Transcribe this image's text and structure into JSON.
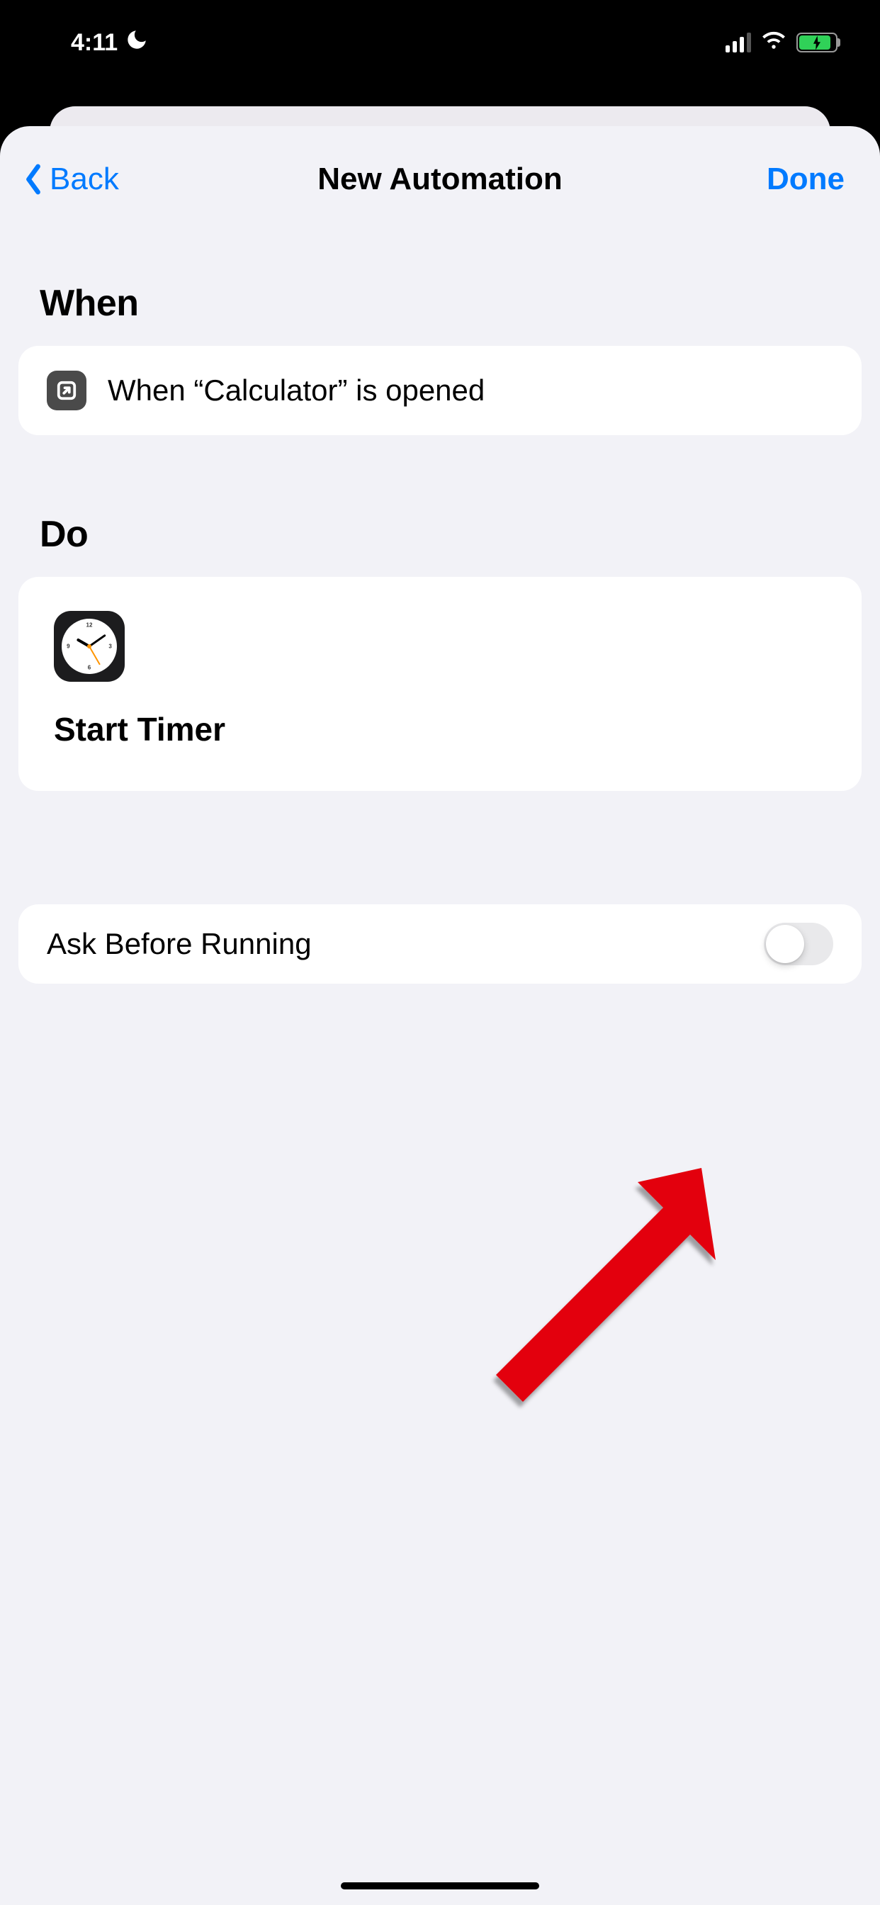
{
  "statusbar": {
    "time": "4:11",
    "dnd": true,
    "battery_charging": true
  },
  "nav": {
    "back_label": "Back",
    "title": "New Automation",
    "done_label": "Done"
  },
  "sections": {
    "when_title": "When",
    "do_title": "Do"
  },
  "when": {
    "trigger_text": "When “Calculator” is opened",
    "trigger_icon": "open-app"
  },
  "do": {
    "action_label": "Start Timer",
    "action_icon": "clock"
  },
  "options": {
    "ask_before_running": {
      "label": "Ask Before Running",
      "value": false
    }
  },
  "annotation": {
    "arrow_color": "#e3000f"
  }
}
